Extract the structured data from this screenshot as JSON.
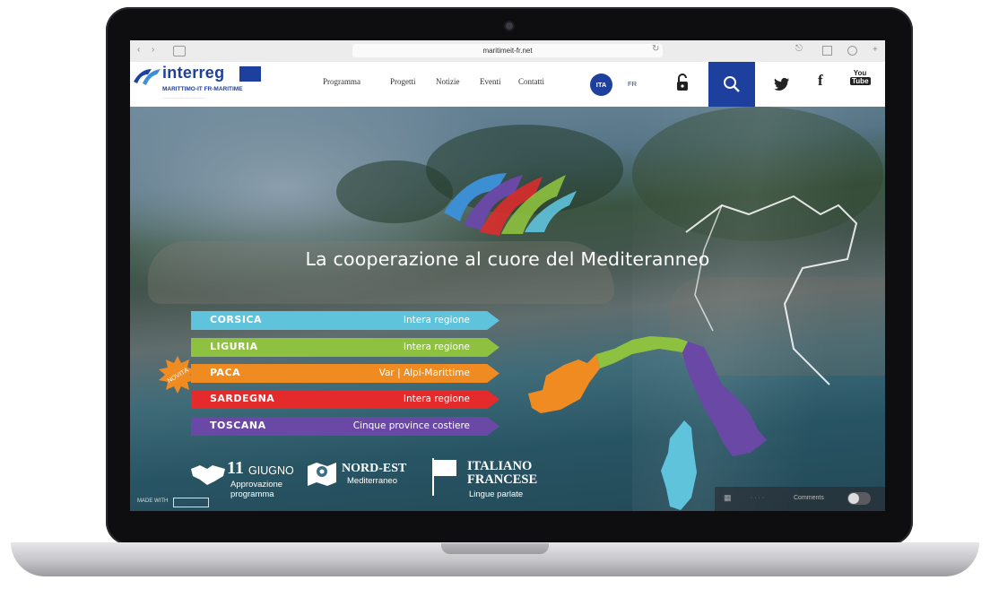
{
  "browser": {
    "url": "maritimeit-fr.net"
  },
  "header": {
    "logo_title": "interreg",
    "logo_subtitle": "MARITTIMO-IT FR-MARITIME",
    "nav": [
      "Programma",
      "Progetti",
      "Notizie",
      "Eventi",
      "Contatti"
    ],
    "lang_active": "ITA",
    "lang_other": "FR",
    "social_youtube": "You Tube"
  },
  "hero": {
    "headline": "La cooperazione al cuore del Mediteranneo",
    "novita": "NOVITÀ",
    "regions": [
      {
        "name": "CORSICA",
        "area": "Intera regione",
        "color": "#5fc3dc"
      },
      {
        "name": "LIGURIA",
        "area": "Intera regione",
        "color": "#8dc13f"
      },
      {
        "name": "PACA",
        "area": "Var  |  Alpi-Marittime",
        "color": "#f08b21"
      },
      {
        "name": "SARDEGNA",
        "area": "Intera regione",
        "color": "#e42a2a"
      },
      {
        "name": "TOSCANA",
        "area": "Cinque province costiere",
        "color": "#6a48a6"
      }
    ]
  },
  "footer": {
    "date_big": "11",
    "date_month": "GIUGNO",
    "date_sub1": "Approvazione",
    "date_sub2": "programma",
    "area_title": "NORD-EST",
    "area_sub": "Mediterraneo",
    "lang_title1": "ITALIANO",
    "lang_title2": "FRANCESE",
    "lang_sub": "Lingue parlate",
    "made_with": "MADE WITH",
    "comments": "Comments"
  },
  "colors": {
    "brand_blue": "#1d3f9e"
  }
}
